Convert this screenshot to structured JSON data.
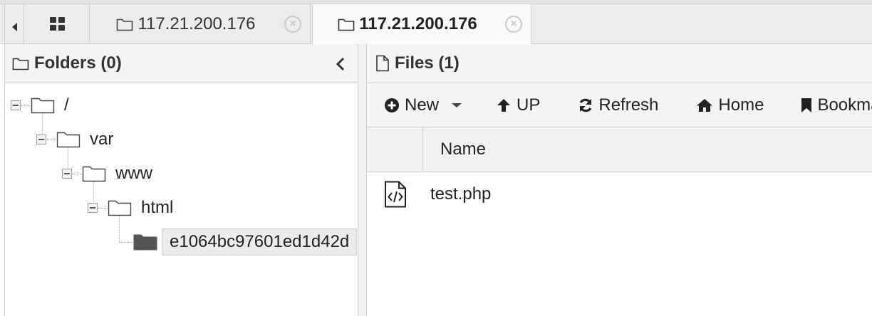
{
  "tabs": [
    {
      "type": "grid"
    },
    {
      "label": "117.21.200.176",
      "active": false,
      "close": "×"
    },
    {
      "label": "117.21.200.176",
      "active": true,
      "close": "×"
    }
  ],
  "folders_panel": {
    "title": "Folders (0)",
    "tree": [
      {
        "label": "/",
        "depth": 0,
        "expanded": true
      },
      {
        "label": "var",
        "depth": 1,
        "expanded": true
      },
      {
        "label": "www",
        "depth": 2,
        "expanded": true
      },
      {
        "label": "html",
        "depth": 3,
        "expanded": true
      },
      {
        "label": "e1064bc97601ed1d42d",
        "depth": 4,
        "selected": true
      }
    ]
  },
  "files_panel": {
    "title": "Files (1)",
    "toolbar": {
      "new_label": "New",
      "up_label": "UP",
      "refresh_label": "Refresh",
      "home_label": "Home",
      "bookmark_label": "Bookma"
    },
    "columns": {
      "name": "Name"
    },
    "files": [
      {
        "name": "test.php",
        "icon": "code-file-icon"
      }
    ]
  },
  "colors": {
    "tab_bg": "#ececec",
    "active_tab_bg": "#f9f9f9",
    "header_bg": "#f4f4f4",
    "border": "#cfcfcf",
    "selected_folder": "#555555"
  }
}
